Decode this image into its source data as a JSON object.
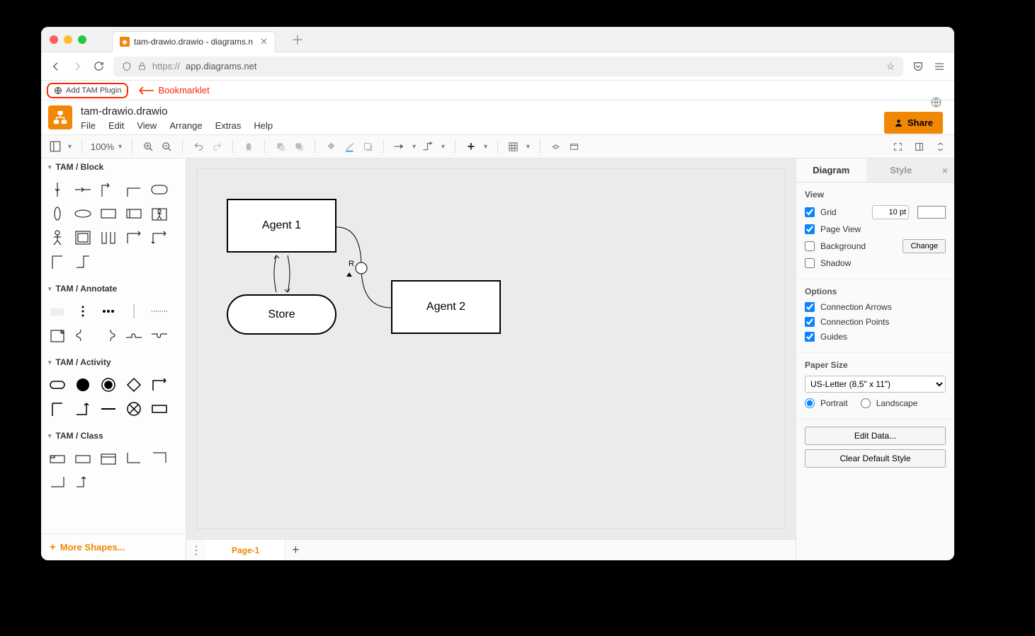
{
  "browser": {
    "tab_title": "tam-drawio.drawio - diagrams.n",
    "url_scheme": "https://",
    "url_host": "app.diagrams.net"
  },
  "bookmark": {
    "label": "Add TAM Plugin",
    "annotation": "Bookmarklet"
  },
  "app": {
    "filename": "tam-drawio.drawio",
    "menus": [
      "File",
      "Edit",
      "View",
      "Arrange",
      "Extras",
      "Help"
    ],
    "share": "Share",
    "zoom": "100%"
  },
  "sidebar": {
    "groups": [
      "TAM / Block",
      "TAM / Annotate",
      "TAM / Activity",
      "TAM / Class"
    ],
    "more": "More Shapes..."
  },
  "diagram": {
    "agent1": "Agent 1",
    "agent2": "Agent 2",
    "store": "Store",
    "r_label": "R"
  },
  "rpanel": {
    "tabs": {
      "diagram": "Diagram",
      "style": "Style"
    },
    "view": {
      "title": "View",
      "grid": "Grid",
      "grid_value": "10 pt",
      "pageview": "Page View",
      "background": "Background",
      "change": "Change",
      "shadow": "Shadow"
    },
    "options": {
      "title": "Options",
      "conn_arrows": "Connection Arrows",
      "conn_points": "Connection Points",
      "guides": "Guides"
    },
    "paper": {
      "title": "Paper Size",
      "value": "US-Letter (8,5\" x 11\")",
      "portrait": "Portrait",
      "landscape": "Landscape"
    },
    "edit_data": "Edit Data...",
    "clear_style": "Clear Default Style"
  },
  "pages": {
    "page1": "Page-1"
  }
}
